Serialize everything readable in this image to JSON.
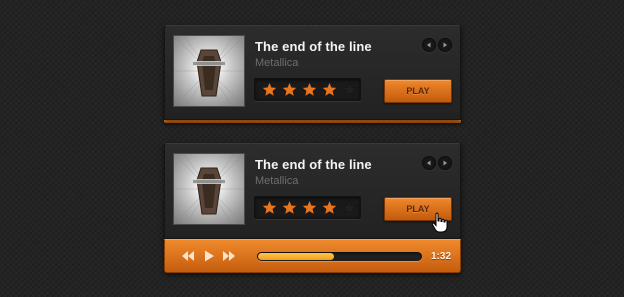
{
  "colors": {
    "accent": "#e8761f",
    "background": "#232323",
    "card": "#272727",
    "star_on": "#e8761f",
    "star_off": "#1f1f1f"
  },
  "players": [
    {
      "album_icon": "metallica-album-cover",
      "title": "The end of the line",
      "artist": "Metallica",
      "prev_icon": "chevron-left-icon",
      "next_icon": "chevron-right-icon",
      "rating": 4,
      "rating_max": 5,
      "play_label": "PLAY"
    },
    {
      "album_icon": "metallica-album-cover",
      "title": "The end of the line",
      "artist": "Metallica",
      "prev_icon": "chevron-left-icon",
      "next_icon": "chevron-right-icon",
      "rating": 4,
      "rating_max": 5,
      "play_label": "PLAY",
      "controls": {
        "rewind_icon": "rewind-icon",
        "play_icon": "play-icon",
        "forward_icon": "fast-forward-icon",
        "progress": 0.47,
        "time": "1:32"
      },
      "cursor_icon": "hand-pointer-icon"
    }
  ]
}
